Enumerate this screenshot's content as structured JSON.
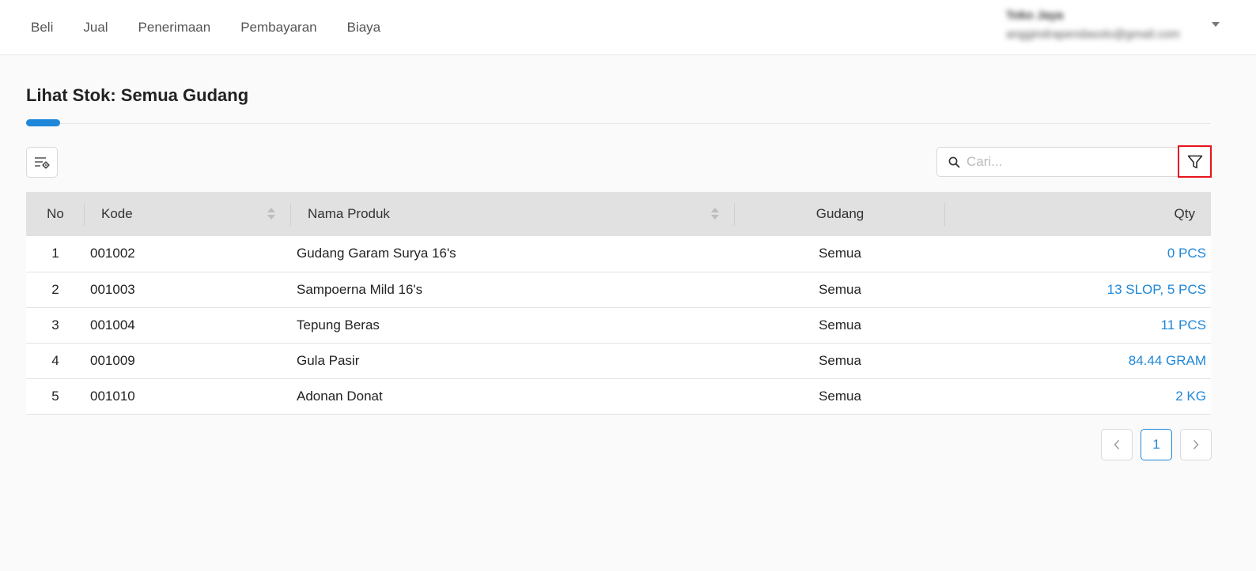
{
  "nav": {
    "items": [
      {
        "label": "Beli"
      },
      {
        "label": "Jual"
      },
      {
        "label": "Penerimaan"
      },
      {
        "label": "Pembayaran"
      },
      {
        "label": "Biaya"
      }
    ]
  },
  "user": {
    "name": "Toko Jaya",
    "email": "anggindrapendasolo@gmail.com"
  },
  "page": {
    "title": "Lihat Stok: Semua Gudang"
  },
  "search": {
    "placeholder": "Cari...",
    "value": ""
  },
  "table": {
    "headers": {
      "no": "No",
      "kode": "Kode",
      "nama": "Nama Produk",
      "gudang": "Gudang",
      "qty": "Qty"
    },
    "rows": [
      {
        "no": "1",
        "kode": "001002",
        "nama": "Gudang Garam Surya 16's",
        "gudang": "Semua",
        "qty": "0 PCS"
      },
      {
        "no": "2",
        "kode": "001003",
        "nama": "Sampoerna Mild 16's",
        "gudang": "Semua",
        "qty": "13 SLOP, 5 PCS"
      },
      {
        "no": "3",
        "kode": "001004",
        "nama": "Tepung Beras",
        "gudang": "Semua",
        "qty": "11 PCS"
      },
      {
        "no": "4",
        "kode": "001009",
        "nama": "Gula Pasir",
        "gudang": "Semua",
        "qty": "84.44 GRAM"
      },
      {
        "no": "5",
        "kode": "001010",
        "nama": "Adonan Donat",
        "gudang": "Semua",
        "qty": "2 KG"
      }
    ]
  },
  "pagination": {
    "prev": "<",
    "current": "1",
    "next": ">"
  },
  "colors": {
    "accent": "#1e87d9",
    "highlight": "#e8141b"
  }
}
